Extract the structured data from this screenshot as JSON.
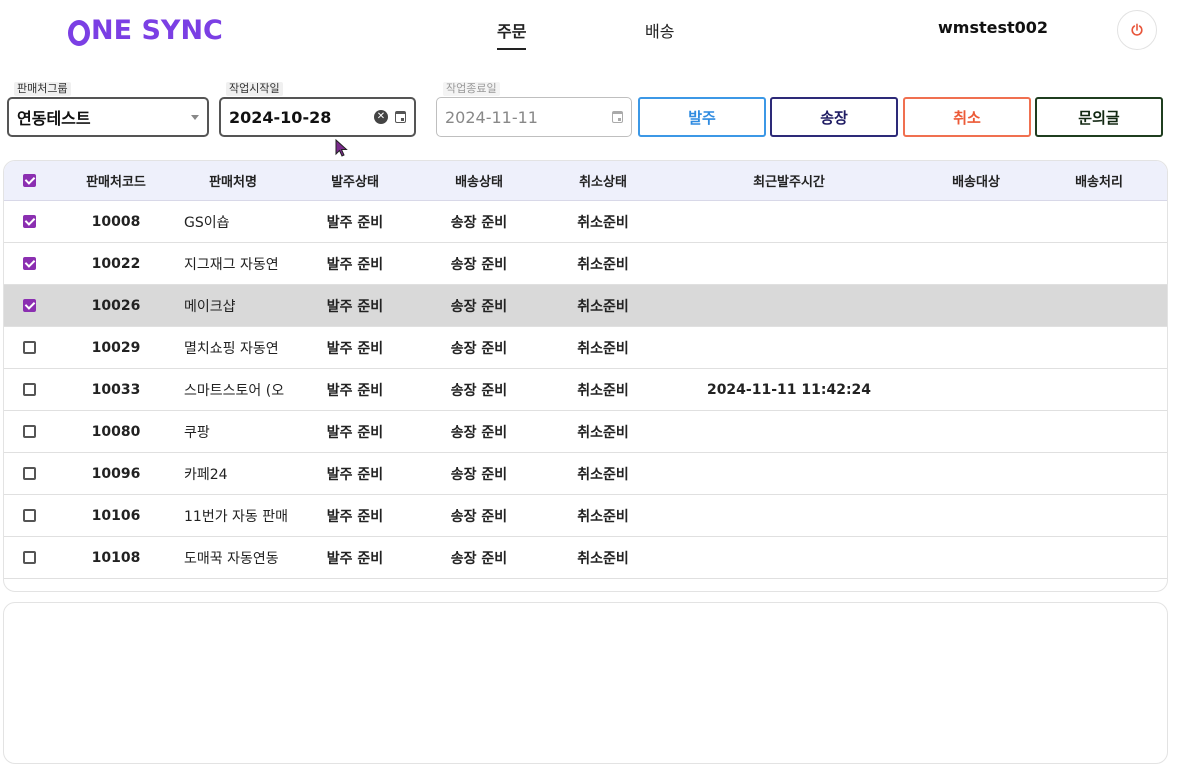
{
  "header": {
    "logo_text": "NE SYNC",
    "tabs": [
      {
        "label": "주문",
        "active": true
      },
      {
        "label": "배송",
        "active": false
      }
    ],
    "username": "wmstest002"
  },
  "filters": {
    "group": {
      "label": "판매처그룹",
      "value": "연동테스트"
    },
    "start_date": {
      "label": "작업시작일",
      "value": "2024-10-28"
    },
    "end_date": {
      "label": "작업종료일",
      "value": "2024-11-11"
    }
  },
  "actions": {
    "order": "발주",
    "invoice": "송장",
    "cancel": "취소",
    "inquiry": "문의글"
  },
  "table": {
    "columns": {
      "code": "판매처코드",
      "name": "판매처명",
      "order_status": "발주상태",
      "ship_status": "배송상태",
      "cancel_status": "취소상태",
      "last_order_time": "최근발주시간",
      "ship_target": "배송대상",
      "ship_process": "배송처리"
    },
    "rows": [
      {
        "checked": true,
        "code": "10008",
        "name": "GS이숍",
        "order_status": "발주 준비",
        "ship_status": "송장 준비",
        "cancel_status": "취소준비",
        "last_order_time": "",
        "ship_target": "",
        "ship_process": ""
      },
      {
        "checked": true,
        "code": "10022",
        "name": "지그재그 자동연",
        "order_status": "발주 준비",
        "ship_status": "송장 준비",
        "cancel_status": "취소준비",
        "last_order_time": "",
        "ship_target": "",
        "ship_process": ""
      },
      {
        "checked": true,
        "code": "10026",
        "name": "메이크샵",
        "order_status": "발주 준비",
        "ship_status": "송장 준비",
        "cancel_status": "취소준비",
        "last_order_time": "",
        "ship_target": "",
        "ship_process": ""
      },
      {
        "checked": false,
        "code": "10029",
        "name": "멸치쇼핑 자동연",
        "order_status": "발주 준비",
        "ship_status": "송장 준비",
        "cancel_status": "취소준비",
        "last_order_time": "",
        "ship_target": "",
        "ship_process": ""
      },
      {
        "checked": false,
        "code": "10033",
        "name": "스마트스토어 (오",
        "order_status": "발주 준비",
        "ship_status": "송장 준비",
        "cancel_status": "취소준비",
        "last_order_time": "2024-11-11 11:42:24",
        "ship_target": "",
        "ship_process": ""
      },
      {
        "checked": false,
        "code": "10080",
        "name": "쿠팡",
        "order_status": "발주 준비",
        "ship_status": "송장 준비",
        "cancel_status": "취소준비",
        "last_order_time": "",
        "ship_target": "",
        "ship_process": ""
      },
      {
        "checked": false,
        "code": "10096",
        "name": "카페24",
        "order_status": "발주 준비",
        "ship_status": "송장 준비",
        "cancel_status": "취소준비",
        "last_order_time": "",
        "ship_target": "",
        "ship_process": ""
      },
      {
        "checked": false,
        "code": "10106",
        "name": "11번가 자동 판매",
        "order_status": "발주 준비",
        "ship_status": "송장 준비",
        "cancel_status": "취소준비",
        "last_order_time": "",
        "ship_target": "",
        "ship_process": ""
      },
      {
        "checked": false,
        "code": "10108",
        "name": "도매꾹 자동연동",
        "order_status": "발주 준비",
        "ship_status": "송장 준비",
        "cancel_status": "취소준비",
        "last_order_time": "",
        "ship_target": "",
        "ship_process": ""
      }
    ]
  },
  "colors": {
    "brand": "#7b3fe4",
    "checkbox": "#8b2fb1",
    "order_btn": "#3c98e6",
    "invoice_btn": "#2d2a78",
    "cancel_btn": "#f07050",
    "inquiry_btn": "#1f3d1f"
  }
}
